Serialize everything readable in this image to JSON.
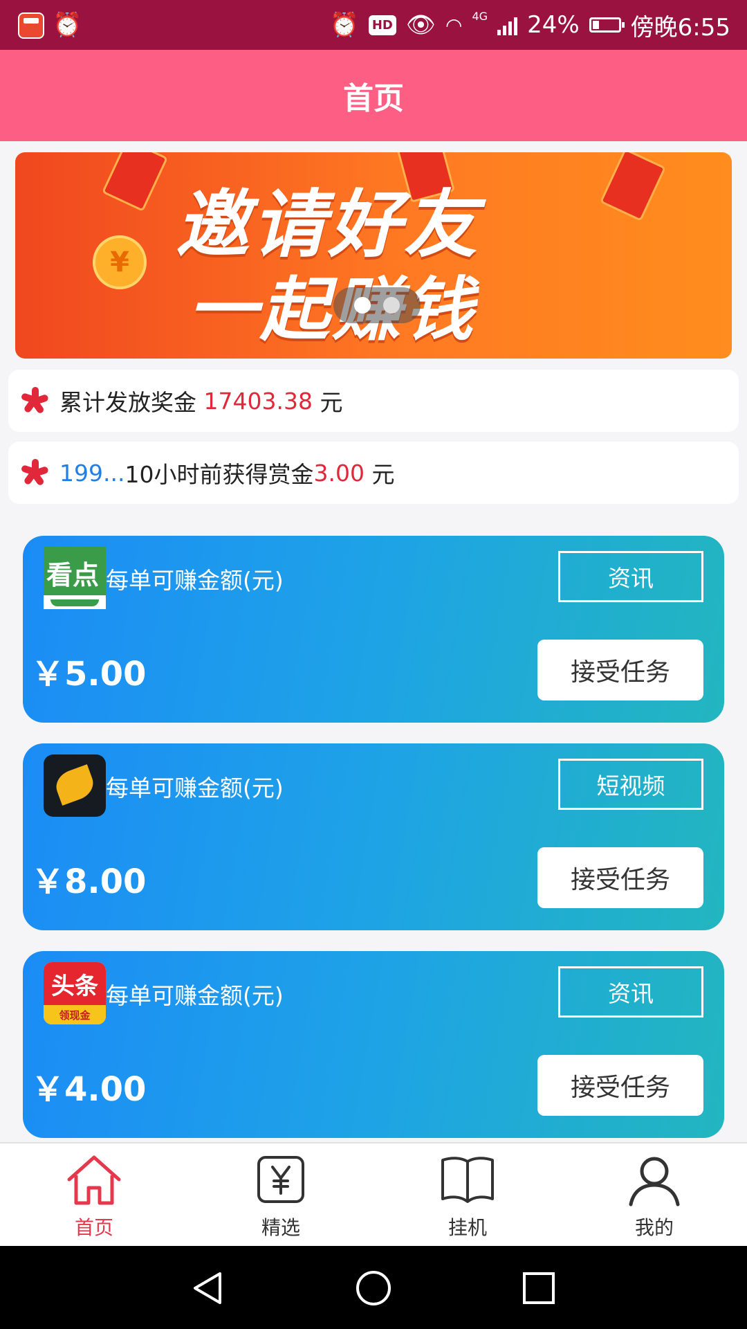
{
  "status_bar": {
    "app_icon": "app-icon",
    "alarm_icon": "alarm-clock-icon",
    "hd_label": "HD",
    "network_label": "4G",
    "battery": "24%",
    "time": "傍晚6:55"
  },
  "header": {
    "title": "首页"
  },
  "banner": {
    "line1": "邀请好友",
    "line2": "一起赚钱",
    "slides": 2,
    "active_slide": 1
  },
  "notices": [
    {
      "prefix": "累计发放奖金 ",
      "amount": "17403.38",
      "suffix": " 元"
    },
    {
      "user": "199...",
      "text": "10小时前获得赏金",
      "amount": "3.00",
      "suffix": " 元"
    }
  ],
  "tasks": [
    {
      "logo": "kandian-logo-icon",
      "label": "每单可赚金额(元)",
      "tag": "资讯",
      "price": "￥5.00",
      "button": "接受任务"
    },
    {
      "logo": "wing-app-logo-icon",
      "label": "每单可赚金额(元)",
      "tag": "短视频",
      "price": "￥8.00",
      "button": "接受任务"
    },
    {
      "logo": "toutiao-logo-icon",
      "label": "每单可赚金额(元)",
      "tag": "资讯",
      "price": "￥4.00",
      "button": "接受任务"
    }
  ],
  "logos": {
    "kandian_text": "看点",
    "toutiao_text": "头条",
    "toutiao_sub": "领现金"
  },
  "bottom_nav": [
    {
      "label": "首页",
      "icon": "home-icon",
      "active": true
    },
    {
      "label": "精选",
      "icon": "yen-box-icon",
      "active": false
    },
    {
      "label": "挂机",
      "icon": "book-icon",
      "active": false
    },
    {
      "label": "我的",
      "icon": "user-icon",
      "active": false
    }
  ],
  "colors": {
    "status_bar": "#9a1340",
    "header": "#fd5f84",
    "accent_red": "#e0283a",
    "accent_blue": "#1f7fe6",
    "card_gradient_start": "#1b8cf6",
    "card_gradient_end": "#22b6bf"
  }
}
